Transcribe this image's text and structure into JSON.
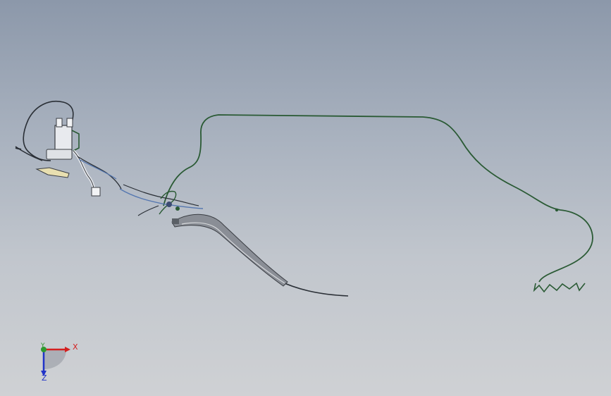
{
  "triad": {
    "x_label": "X",
    "y_label": "Y",
    "z_label": "Z",
    "x_color": "#d42020",
    "y_color": "#2f9a2f",
    "z_color": "#2033c8"
  },
  "colors": {
    "background_top": "#8c98aa",
    "background_bottom": "#cfd1d4",
    "wire_green": "#2a5a34",
    "wire_dark": "#2a2f36",
    "wire_blue": "#5577b0",
    "part_gray": "#8a8e96"
  }
}
